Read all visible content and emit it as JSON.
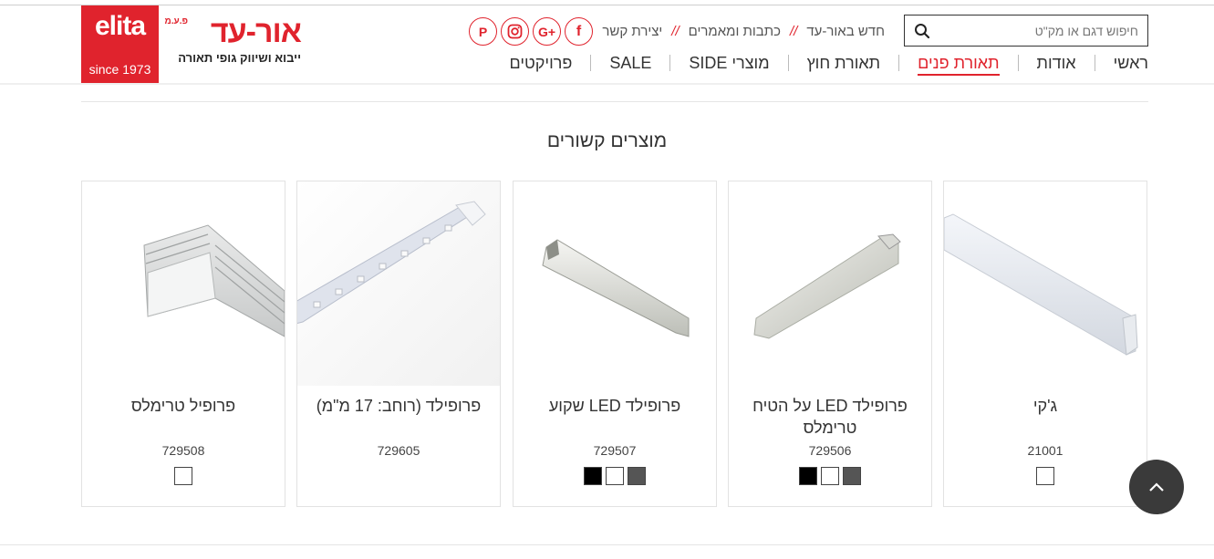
{
  "header": {
    "logo_elita": {
      "brand": "elita",
      "since": "since 1973"
    },
    "logo_or": {
      "name": "אור-עד",
      "small": "פ.ע.מ",
      "tagline": "ייבוא ושיווק גופי תאורה"
    },
    "social": [
      {
        "icon": "pinterest-icon",
        "glyph": "P"
      },
      {
        "icon": "instagram-icon",
        "glyph": "◎"
      },
      {
        "icon": "google-plus-icon",
        "glyph": "G+"
      },
      {
        "icon": "facebook-icon",
        "glyph": "f"
      }
    ],
    "top_links": [
      "חדש באור-עד",
      "כתבות ומאמרים",
      "יצירת קשר"
    ],
    "top_link_separator": "//",
    "search": {
      "placeholder": "חיפוש דגם או מק\"ט",
      "value": ""
    },
    "nav": [
      {
        "label": "ראשי",
        "active": false
      },
      {
        "label": "אודות",
        "active": false
      },
      {
        "label": "תאורת פנים",
        "active": true
      },
      {
        "label": "תאורת חוץ",
        "active": false
      },
      {
        "label": "מוצרי SIDE",
        "active": false
      },
      {
        "label": "SALE",
        "active": false
      },
      {
        "label": "פרויקטים",
        "active": false
      }
    ]
  },
  "section": {
    "title": "מוצרים קשורים"
  },
  "products": [
    {
      "title": "ג'קי",
      "code": "21001",
      "swatches": [
        "#ffffff"
      ]
    },
    {
      "title": "פרופילד LED על הטיח טרימלס",
      "code": "729506",
      "swatches": [
        "#000000",
        "#ffffff",
        "#555555"
      ]
    },
    {
      "title": "פרופילד LED שקוע",
      "code": "729507",
      "swatches": [
        "#000000",
        "#ffffff",
        "#555555"
      ]
    },
    {
      "title": "פרופילד (רוחב: 17 מ\"מ)",
      "code": "729605",
      "swatches": []
    },
    {
      "title": "פרופיל טרימלס",
      "code": "729508",
      "swatches": [
        "#ffffff"
      ]
    }
  ],
  "colors": {
    "accent": "#e0232d",
    "to_top_button": "#3a3a3a"
  },
  "to_top": {
    "icon": "chevron-up-icon"
  }
}
